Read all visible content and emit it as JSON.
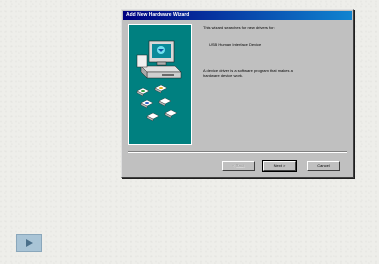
{
  "wizard": {
    "title": "Add New Hardware Wizard",
    "intro_text": "This wizard searches for new drivers for:",
    "device_name": "USB Human Interface Device",
    "description_line1": "A device driver is a software program that makes a",
    "description_line2": "hardware device work.",
    "buttons": {
      "back": "< Back",
      "next": "Next >",
      "cancel": "Cancel"
    }
  },
  "icons": {
    "art": "computer-with-driver-disks-illustration",
    "play": "play-icon"
  },
  "colors": {
    "title_bar": "#000080",
    "art_panel": "#008080",
    "window_face": "#c0c0c0",
    "play_button": "#a9c4d6"
  }
}
